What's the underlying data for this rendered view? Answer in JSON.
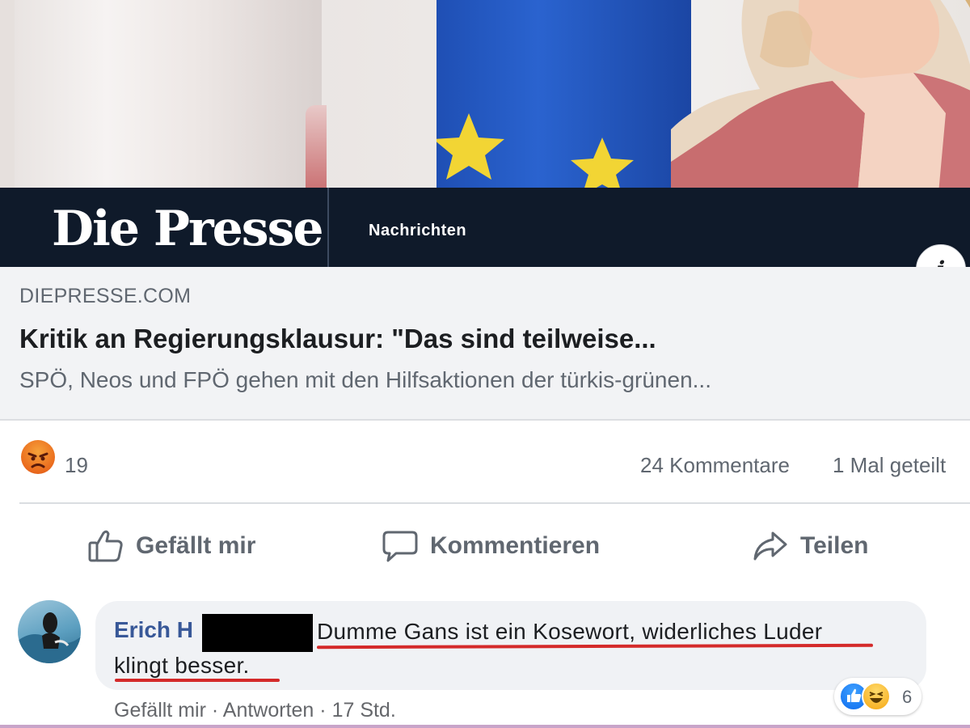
{
  "brand": {
    "logo": "Die Presse",
    "section": "Nachrichten"
  },
  "link_preview": {
    "domain": "DIEPRESSE.COM",
    "headline": "Kritik an Regierungsklausur: \"Das sind teilweise...",
    "description": "SPÖ, Neos und FPÖ gehen mit den Hilfsaktionen der türkis-grünen...",
    "info_icon": "i"
  },
  "stats": {
    "reaction_icon": "angry-reaction-icon",
    "reaction_count": "19",
    "comments": "24 Kommentare",
    "shares": "1 Mal geteilt"
  },
  "actions": {
    "like": "Gefällt mir",
    "comment": "Kommentieren",
    "share": "Teilen"
  },
  "comment": {
    "author_visible": "Erich H",
    "text_line1": "Dumme Gans ist ein Kosewort, widerliches Luder",
    "text_line2": "klingt besser.",
    "reactions_count": "6",
    "meta_like": "Gefällt mir",
    "meta_reply": "Antworten",
    "meta_time": "17 Std.",
    "meta_sep": "·"
  },
  "colors": {
    "brand_bar": "#0f1a2a",
    "link_author": "#385898",
    "underline": "#d42a2a",
    "muted_text": "#606770"
  }
}
